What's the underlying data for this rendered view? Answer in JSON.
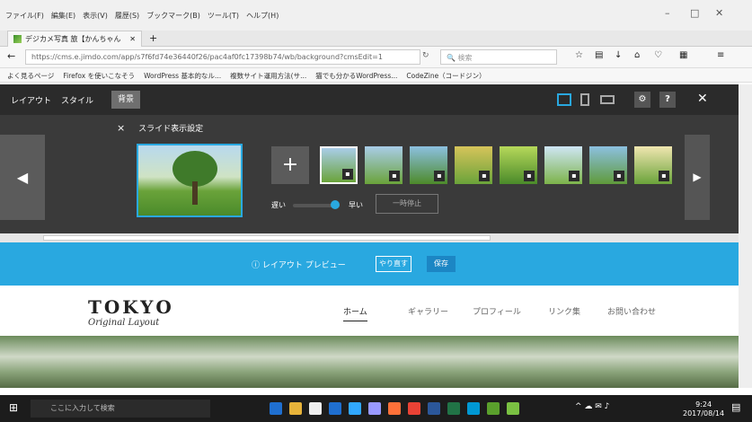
{
  "browser": {
    "menu": [
      "ファイル(F)",
      "編集(E)",
      "表示(V)",
      "履歴(S)",
      "ブックマーク(B)",
      "ツール(T)",
      "ヘルプ(H)"
    ],
    "tab_title": "デジカメ写真 旅【かんちゃん",
    "url": "https://cms.e.jimdo.com/app/s7f6fd74e36440f26/pac4af0fc17398b74/wb/background?cmsEdit=1",
    "search_placeholder": "検索",
    "bookmarks": [
      "よく見るページ",
      "Firefox を使いこなそう",
      "WordPress 基本的なル...",
      "複数サイト運用方法(サ...",
      "猫でも分かるWordPress...",
      "CodeZine（コードジン）"
    ]
  },
  "editor": {
    "tabs": [
      "レイアウト",
      "スタイル",
      "背景"
    ],
    "close_symbol": "×",
    "slide_title": "スライド表示設定",
    "add_symbol": "+",
    "speed_slow": "遅い",
    "speed_fast": "早い",
    "pause_label": "一時停止",
    "slider_value": 0.8
  },
  "preview": {
    "label": "レイアウト プレビュー",
    "redo_label": "やり直す",
    "save_label": "保存"
  },
  "site": {
    "logo": "TOKYO",
    "logo_sub": "Original Layout",
    "nav": [
      "ホーム",
      "ギャラリー",
      "プロフィール",
      "リンク集",
      "お問い合わせ"
    ]
  },
  "taskbar": {
    "search_placeholder": "ここに入力して検索",
    "time": "9:24",
    "date": "2017/08/14"
  },
  "colors": {
    "accent": "#29a8e0",
    "dark_panel": "#2b2b2b"
  }
}
